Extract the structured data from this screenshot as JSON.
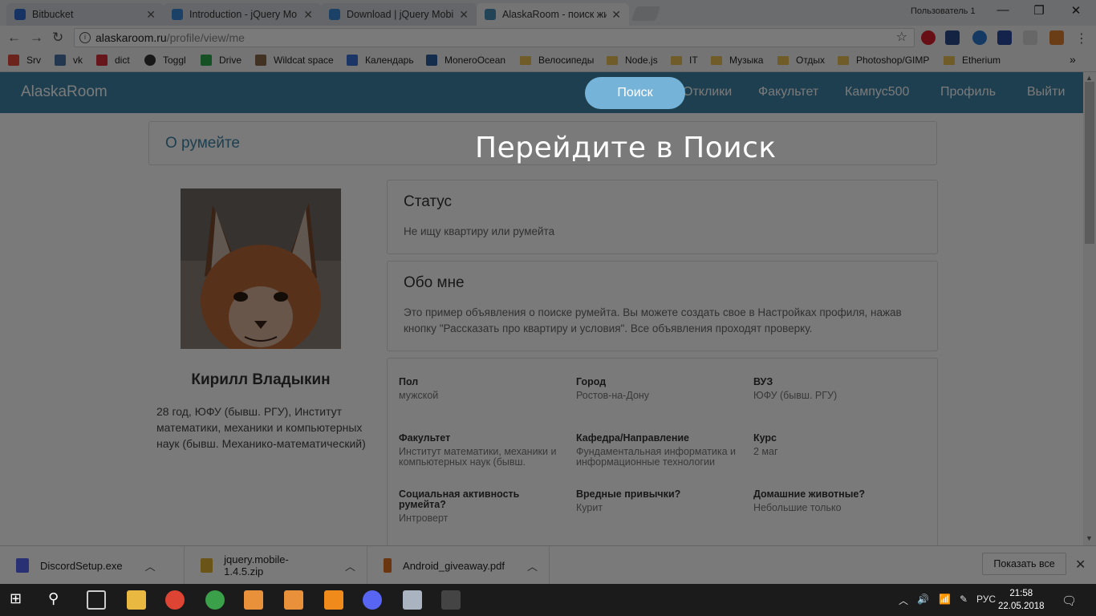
{
  "browser": {
    "tabs": [
      {
        "title": "Bitbucket",
        "color": "#2e6ccf"
      },
      {
        "title": "Introduction - jQuery Mo",
        "color": "#3a8ad6"
      },
      {
        "title": "Download | jQuery Mobil",
        "color": "#3a8ad6"
      },
      {
        "title": "AlaskaRoom - поиск жил",
        "color": "#4a8db5"
      }
    ],
    "user_label": "Пользователь 1",
    "url_host": "alaskaroom.ru",
    "url_path": "/profile/view/me",
    "bookmarks": [
      {
        "label": "Srv",
        "icon": "apps-grid-icon",
        "color": "#e04a3a"
      },
      {
        "label": "vk",
        "icon": "vk-icon",
        "color": "#4a76a8"
      },
      {
        "label": "dict",
        "icon": "dict-icon",
        "color": "#d8303a"
      },
      {
        "label": "Toggl",
        "icon": "toggl-icon",
        "color": "#333333"
      },
      {
        "label": "Drive",
        "icon": "drive-icon",
        "color": "#2fa84f"
      },
      {
        "label": "Wildcat space",
        "icon": "wildcat-icon",
        "color": "#8a6a4a"
      },
      {
        "label": "Календарь",
        "icon": "calendar-icon",
        "color": "#3b6fd8"
      },
      {
        "label": "MoneroOcean",
        "icon": "monero-icon",
        "color": "#2a5fa0"
      },
      {
        "label": "Велосипеды",
        "icon": "folder-icon",
        "color": "#e8c054"
      },
      {
        "label": "Node.js",
        "icon": "folder-icon",
        "color": "#e8c054"
      },
      {
        "label": "IT",
        "icon": "folder-icon",
        "color": "#e8c054"
      },
      {
        "label": "Музыка",
        "icon": "folder-icon",
        "color": "#e8c054"
      },
      {
        "label": "Отдых",
        "icon": "folder-icon",
        "color": "#e8c054"
      },
      {
        "label": "Photoshop/GIMP",
        "icon": "folder-icon",
        "color": "#e8c054"
      },
      {
        "label": "Etherium",
        "icon": "folder-icon",
        "color": "#e8c054"
      }
    ],
    "more_bookmarks": "»"
  },
  "site": {
    "brand": "AlaskaRoom",
    "nav": [
      "Поиск",
      "Отклики",
      "Факультет",
      "Кампус500",
      "Профиль",
      "Выйти"
    ],
    "about_title": "О румейте",
    "hint": "Перейдите в Поиск",
    "user": {
      "name": "Кирилл Владыкин",
      "info": "28 год, ЮФУ (бывш. РГУ), Институт математики, механики и компьютерных наук (бывш. Механико-математический)"
    },
    "status": {
      "title": "Статус",
      "text": "Не ищу квартиру или румейта"
    },
    "about": {
      "title": "Обо мне",
      "text": "Это пример объявления о поиске румейта. Вы можете создать свое в Настройках профиля, нажав кнопку \"Рассказать про квартиру и условия\". Все объявления проходят проверку."
    },
    "fields": [
      {
        "label": "Пол",
        "value": "мужской"
      },
      {
        "label": "Город",
        "value": "Ростов-на-Дону"
      },
      {
        "label": "ВУЗ",
        "value": "ЮФУ (бывш. РГУ)"
      },
      {
        "label": "Факультет",
        "value": "Институт математики, механики и компьютерных наук (бывш."
      },
      {
        "label": "Кафедра/Направление",
        "value": "Фундаментальная информатика и информационные технологии"
      },
      {
        "label": "Курс",
        "value": "2 маг"
      },
      {
        "label": "Социальная активность румейта?",
        "value": "Интроверт"
      },
      {
        "label": "Вредные привычки?",
        "value": "Курит"
      },
      {
        "label": "Домашние животные?",
        "value": "Небольшие только"
      }
    ]
  },
  "downloads": {
    "items": [
      {
        "name": "DiscordSetup.exe",
        "color": "#5865f2"
      },
      {
        "name": "jquery.mobile-1.4.5.zip",
        "color": "#e0b030"
      },
      {
        "name": "Android_giveaway.pdf",
        "color": "#e07020"
      }
    ],
    "show_all": "Показать все"
  },
  "taskbar": {
    "lang": "РУС",
    "time": "21:58",
    "date": "22.05.2018"
  }
}
